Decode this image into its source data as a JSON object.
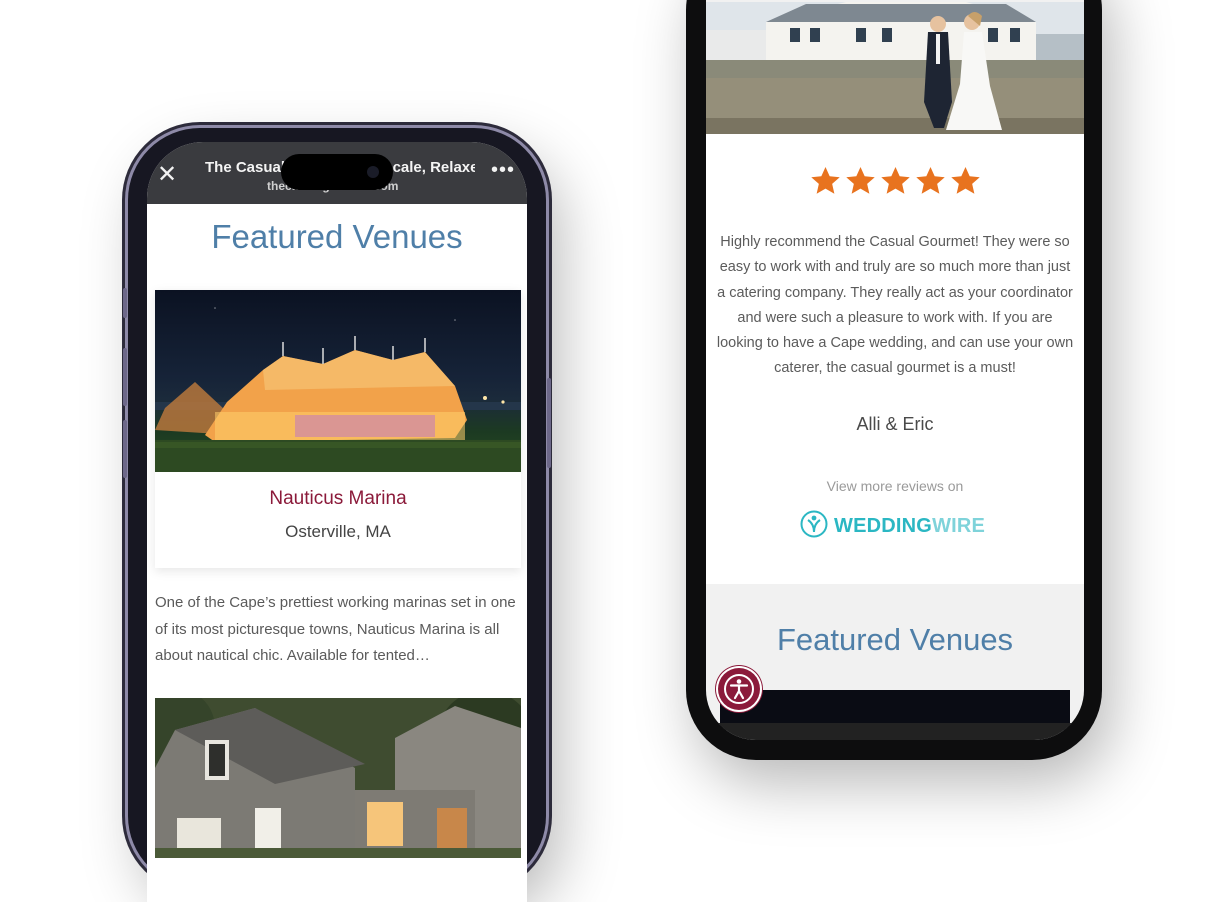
{
  "left_phone": {
    "browser": {
      "close_icon": "close-icon",
      "title": "The Casual Gourmet | Upscale, Relaxed Cape Co...",
      "url": "thecasualgourmet.com",
      "more_icon": "more-dots-icon"
    },
    "heading": "Featured Venues",
    "venue": {
      "name": "Nauticus Marina",
      "location": "Osterville, MA",
      "description": "One of the Cape’s prettiest working marinas set in one of its most picturesque towns, Nauticus Marina is all about nautical chic. Available for tented…"
    }
  },
  "right_phone": {
    "rating_stars": 5,
    "star_color": "#e8731f",
    "review": "Highly recommend the Casual Gourmet! They were so easy to work with and truly are so much more than just a catering company. They really act as your coordinator and were such a pleasure to work with. If you are looking to have a Cape wedding, and can use your own caterer, the casual gourmet is a must!",
    "reviewer": "Alli & Eric",
    "view_more": "View more reviews on",
    "weddingwire": {
      "part1": "WEDDING",
      "part2": "WIRE"
    },
    "heading": "Featured Venues",
    "accessibility_icon": "accessibility-icon"
  },
  "colors": {
    "heading_blue": "#4f7fa8",
    "venue_name": "#8b1a3a",
    "weddingwire": "#2bb7c3",
    "accessibility_button": "#8b1a3a"
  }
}
